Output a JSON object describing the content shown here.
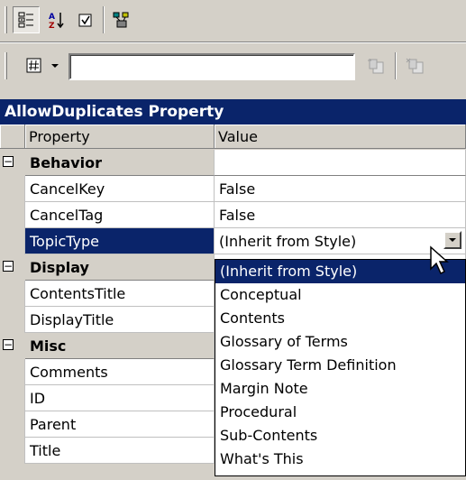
{
  "toolbar1": {
    "buttons": [
      {
        "name": "categorized-icon",
        "pressed": true
      },
      {
        "name": "sort-alpha-icon",
        "pressed": false
      },
      {
        "name": "property-pages-icon",
        "pressed": false
      },
      {
        "name": "build-icon",
        "pressed": false
      }
    ]
  },
  "toolbar2": {
    "object_value": "",
    "buttons": [
      "add-object-icon",
      "remove-object-icon"
    ]
  },
  "panel": {
    "title": "AllowDuplicates Property"
  },
  "grid": {
    "col_property": "Property",
    "col_value": "Value",
    "rows": [
      {
        "type": "category",
        "label": "Behavior",
        "expanded": true
      },
      {
        "type": "prop",
        "label": "CancelKey",
        "value": "False"
      },
      {
        "type": "prop",
        "label": "CancelTag",
        "value": "False"
      },
      {
        "type": "prop",
        "label": "TopicType",
        "value": "(Inherit from Style)",
        "selected": true
      },
      {
        "type": "category",
        "label": "Display",
        "expanded": true
      },
      {
        "type": "prop",
        "label": "ContentsTitle",
        "value": ""
      },
      {
        "type": "prop",
        "label": "DisplayTitle",
        "value": ""
      },
      {
        "type": "category",
        "label": "Misc",
        "expanded": true
      },
      {
        "type": "prop",
        "label": "Comments",
        "value": ""
      },
      {
        "type": "prop",
        "label": "ID",
        "value": ""
      },
      {
        "type": "prop",
        "label": "Parent",
        "value": ""
      },
      {
        "type": "prop",
        "label": "Title",
        "value": ""
      }
    ]
  },
  "dropdown": {
    "items": [
      "(Inherit from Style)",
      "Conceptual",
      "Contents",
      "Glossary of Terms",
      "Glossary Term Definition",
      "Margin Note",
      "Procedural",
      "Sub-Contents",
      "What's This"
    ],
    "selected_index": 0
  },
  "colors": {
    "titlebar": "#0a246a",
    "face": "#d4d0c8",
    "highlight": "#0a246a"
  }
}
